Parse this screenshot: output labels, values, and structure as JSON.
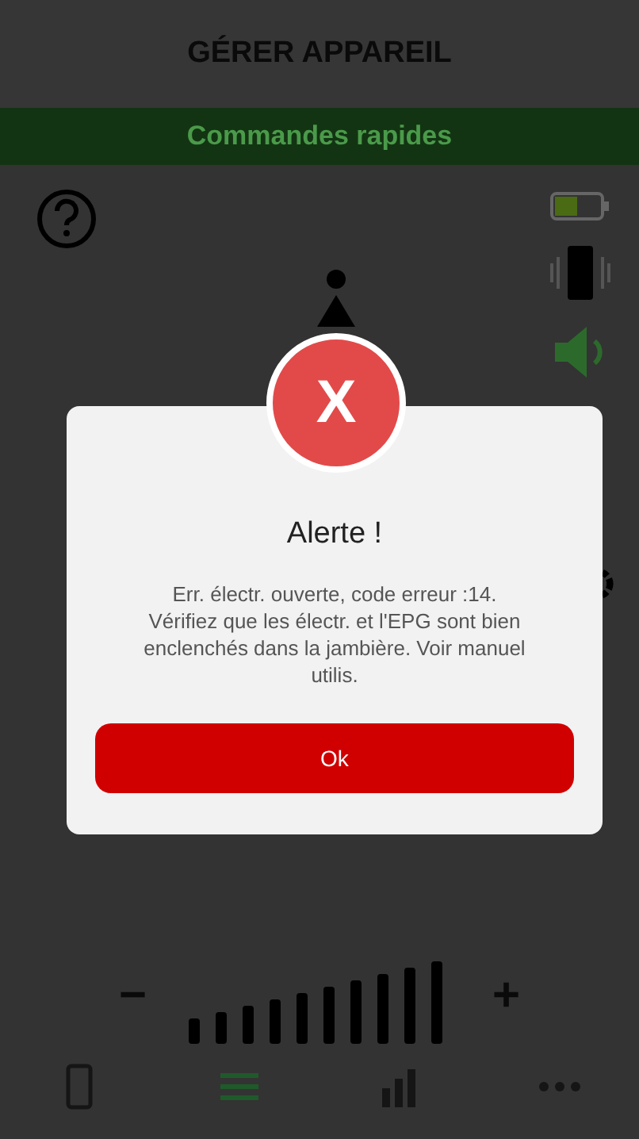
{
  "header": {
    "title": "GÉRER APPAREIL"
  },
  "section_bar": {
    "title": "Commandes rapides"
  },
  "volume": {
    "minus": "−",
    "plus": "+"
  },
  "bottom_nav": [
    {
      "kind": "device",
      "selected": false
    },
    {
      "kind": "controls",
      "selected": true
    },
    {
      "kind": "stats",
      "selected": false
    },
    {
      "kind": "more",
      "selected": false
    }
  ],
  "dialog": {
    "title": "Alerte !",
    "icon": "X",
    "message": "Err. électr. ouverte, code erreur :14. Vérifiez que les électr. et l'EPG sont bien enclenchés dans la jambière. Voir manuel utilis.",
    "button": "Ok"
  }
}
